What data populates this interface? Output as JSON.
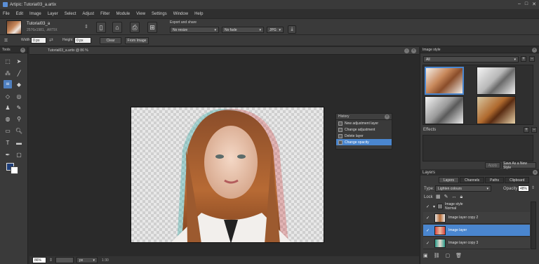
{
  "window": {
    "title": "Artipic: Tutorial03_a.artix"
  },
  "menu": [
    "File",
    "Edit",
    "Image",
    "Layer",
    "Select",
    "Adjust",
    "Filter",
    "Module",
    "View",
    "Settings",
    "Window",
    "Help"
  ],
  "document": {
    "name": "Tutorial03_a",
    "info": "2576x1981, .ARTIX"
  },
  "export": {
    "label": "Export and share",
    "dd1": "No resize",
    "dd2": "No fade",
    "dd3": "JPG"
  },
  "options": {
    "width_label": "Width",
    "width_value": "0 px",
    "height_label": "Height",
    "height_value": "0 px",
    "clear_label": "Clear",
    "from_image_label": "From Image"
  },
  "tools_panel": {
    "title": "Tools"
  },
  "canvas": {
    "title": "Tutorial03_a.artix @ 86 %",
    "zoom": "86%",
    "unit": "px",
    "position": "1:30"
  },
  "history": {
    "title": "History",
    "items": [
      "New adjustment layer",
      "Change adjustment",
      "Delete layer",
      "Change opacity"
    ]
  },
  "image_style": {
    "title": "Image style",
    "filter": "All"
  },
  "effects": {
    "title": "Effects",
    "apply_label": "Apply",
    "save_label": "Save As a New Style"
  },
  "layers": {
    "panel_title": "Layers",
    "tabs": [
      "Layers",
      "Channels",
      "Paths",
      "Clipboard"
    ],
    "type_label": "Type:",
    "blend_mode": "Lighten colours",
    "opacity_label": "Opacity",
    "opacity_value": "48%",
    "lock_label": "Lock",
    "group_name": "Image style",
    "group_mode": "Normal",
    "rows": [
      "Image layer copy 2",
      "Image layer",
      "Image layer copy 3"
    ]
  },
  "colors": {
    "accent": "#4a86cf",
    "panel": "#3a3a3a",
    "dark": "#262626"
  }
}
